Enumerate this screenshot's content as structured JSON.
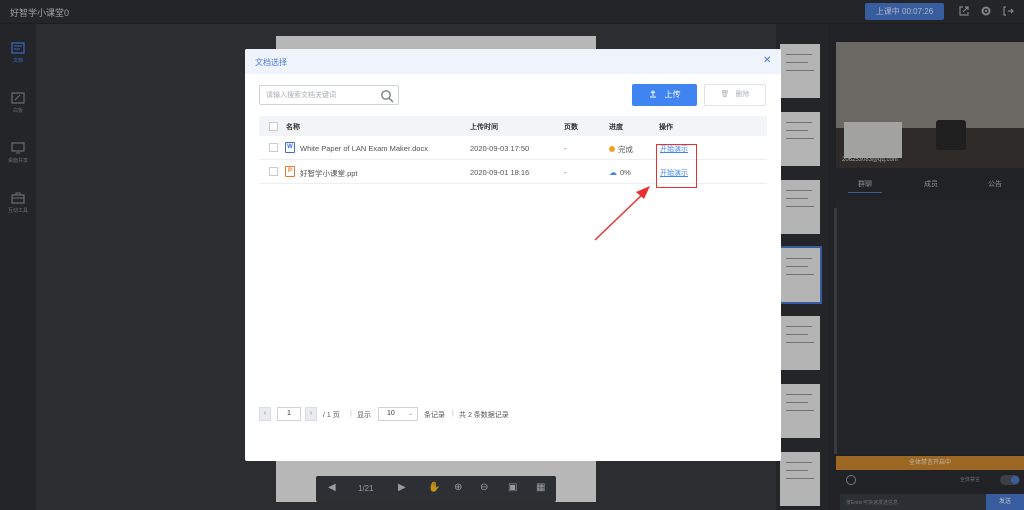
{
  "app": {
    "title": "好智学小课堂0"
  },
  "topbar": {
    "live_status": "上课中 00:07:26"
  },
  "leftrail": {
    "items": [
      {
        "label": "文档",
        "icon": "document-icon"
      },
      {
        "label": "白板",
        "icon": "whiteboard-icon"
      },
      {
        "label": "桌面共享",
        "icon": "screen-share-icon"
      },
      {
        "label": "互动工具",
        "icon": "toolbox-icon"
      }
    ]
  },
  "stage": {
    "page_indicator": "1/21"
  },
  "rightpanel": {
    "video_caption": "206253083@qq.com",
    "tabs": [
      "群聊",
      "成员",
      "公告"
    ],
    "mute_banner": "全体禁言开启中",
    "mute_toggle_label": "全体禁言",
    "chat_placeholder": "按Enter可快速发送信息",
    "send_label": "发送"
  },
  "modal": {
    "title": "文档选择",
    "search_placeholder": "请输入搜索文档关键词",
    "upload_label": "上传",
    "delete_label": "删除",
    "columns": [
      "名称",
      "上传时间",
      "页数",
      "进度",
      "操作"
    ],
    "rows": [
      {
        "name": "White Paper of LAN Exam Maker.docx",
        "type": "W",
        "time": "2020-09-03 17:50",
        "pages": "-",
        "progress": "完成",
        "progress_status": "done",
        "action": "开始演示"
      },
      {
        "name": "好智学小课堂.ppt",
        "type": "P",
        "time": "2020-09-01 18:16",
        "pages": "-",
        "progress": "0%",
        "progress_status": "uploading",
        "action": "开始演示"
      }
    ],
    "pagination": {
      "current_page": "1",
      "total_pages_text": "/ 1 页",
      "show_label": "显示",
      "page_size": "10",
      "records_label": "条记录",
      "total_text": "共 2 条数据记录"
    }
  },
  "colors": {
    "accent": "#3f84f0",
    "highlight": "#e8312e",
    "done_status": "#f0a020",
    "uploading_status": "#3f84f0"
  }
}
